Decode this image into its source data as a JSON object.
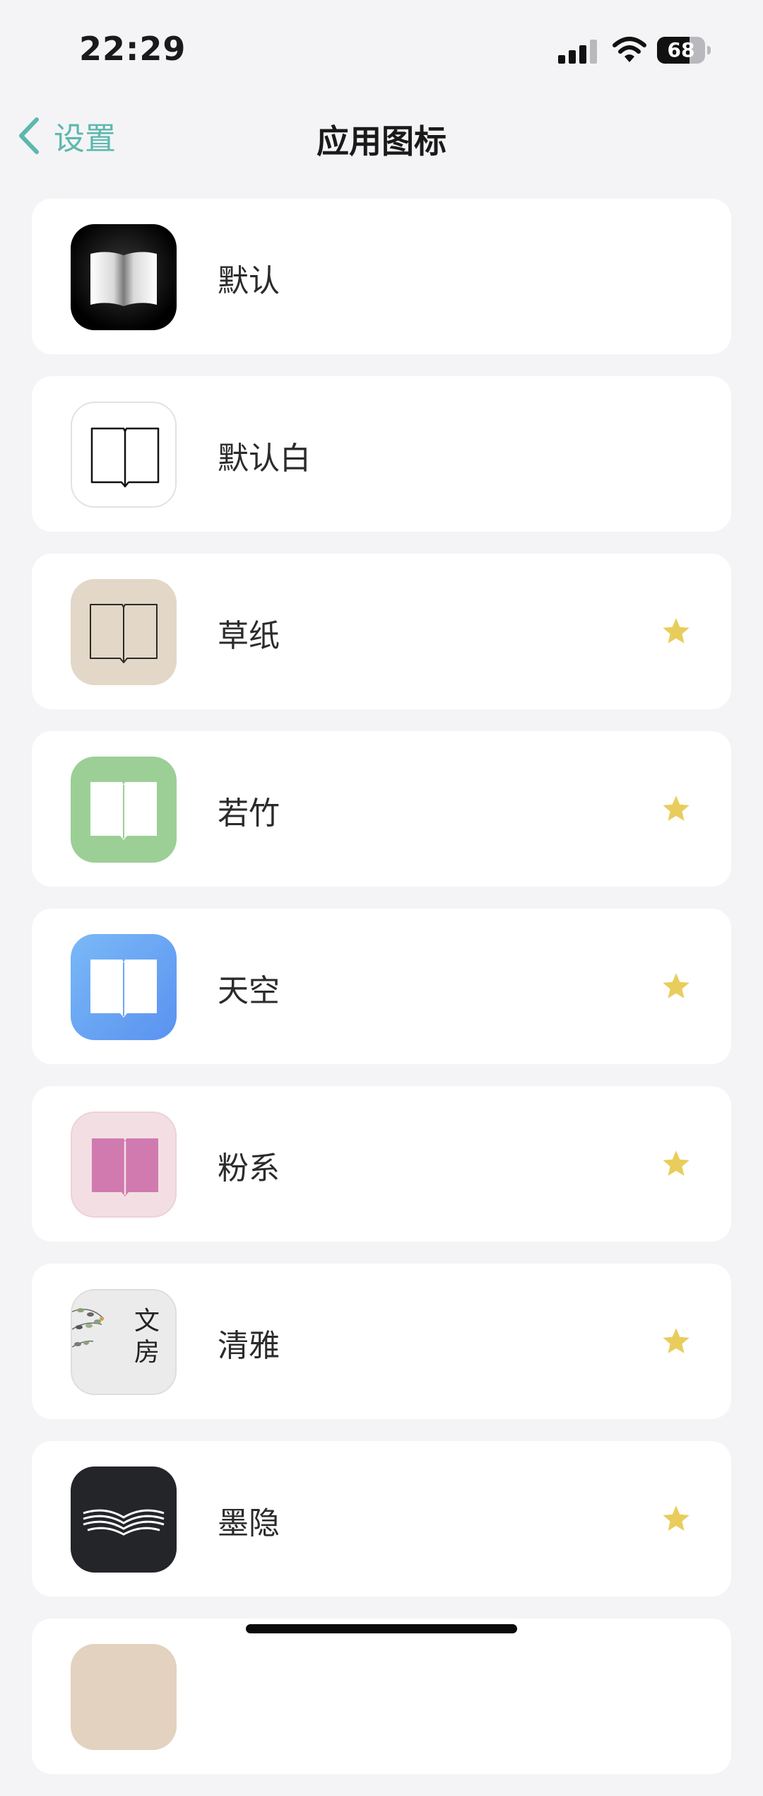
{
  "status_bar": {
    "time": "22:29",
    "battery": "68",
    "battery_level": 0.68
  },
  "nav": {
    "back_label": "设置",
    "title": "应用图标"
  },
  "colors": {
    "accent": "#5cb8ad",
    "star": "#e9cd5c",
    "background": "#f4f4f6"
  },
  "icons": [
    {
      "label": "默认",
      "premium": false,
      "icon": "book-black-icon"
    },
    {
      "label": "默认白",
      "premium": false,
      "icon": "book-white-icon"
    },
    {
      "label": "草纸",
      "premium": true,
      "icon": "book-paper-icon"
    },
    {
      "label": "若竹",
      "premium": true,
      "icon": "book-green-icon"
    },
    {
      "label": "天空",
      "premium": true,
      "icon": "book-sky-icon"
    },
    {
      "label": "粉系",
      "premium": true,
      "icon": "book-pink-icon"
    },
    {
      "label": "清雅",
      "premium": true,
      "icon": "wenfang-icon",
      "icon_text": "文房"
    },
    {
      "label": "墨隐",
      "premium": true,
      "icon": "book-ink-icon"
    },
    {
      "label": "",
      "premium": false,
      "icon": "book-partial-icon"
    }
  ]
}
